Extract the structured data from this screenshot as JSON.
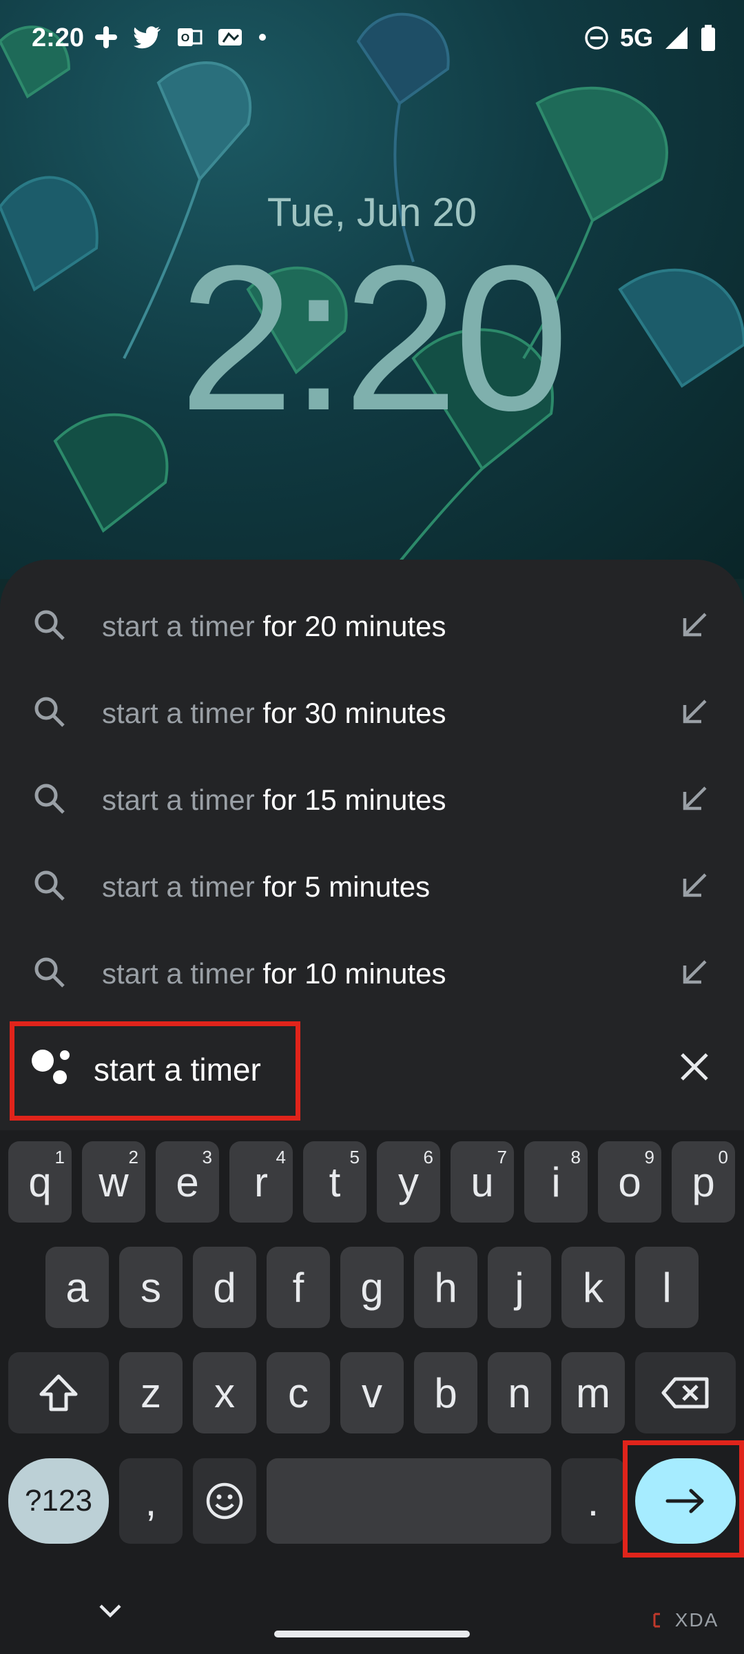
{
  "status_bar": {
    "time": "2:20",
    "network": "5G",
    "icons_left": [
      "slack-icon",
      "twitter-icon",
      "outlook-icon",
      "mlb-icon",
      "dot-icon"
    ],
    "icons_right": [
      "do-not-disturb-icon",
      "signal-icon",
      "battery-icon"
    ]
  },
  "lock_screen": {
    "date": "Tue, Jun 20",
    "clock": "2:20"
  },
  "suggestions": [
    {
      "prefix": "start a timer",
      "suffix": " for 20 minutes"
    },
    {
      "prefix": "start a timer",
      "suffix": " for 30 minutes"
    },
    {
      "prefix": "start a timer",
      "suffix": " for 15 minutes"
    },
    {
      "prefix": "start a timer",
      "suffix": " for 5 minutes"
    },
    {
      "prefix": "start a timer",
      "suffix": " for 10 minutes"
    }
  ],
  "search": {
    "query": "start a timer"
  },
  "keyboard": {
    "row1": [
      {
        "k": "q",
        "h": "1"
      },
      {
        "k": "w",
        "h": "2"
      },
      {
        "k": "e",
        "h": "3"
      },
      {
        "k": "r",
        "h": "4"
      },
      {
        "k": "t",
        "h": "5"
      },
      {
        "k": "y",
        "h": "6"
      },
      {
        "k": "u",
        "h": "7"
      },
      {
        "k": "i",
        "h": "8"
      },
      {
        "k": "o",
        "h": "9"
      },
      {
        "k": "p",
        "h": "0"
      }
    ],
    "row2": [
      "a",
      "s",
      "d",
      "f",
      "g",
      "h",
      "j",
      "k",
      "l"
    ],
    "row3": [
      "z",
      "x",
      "c",
      "v",
      "b",
      "n",
      "m"
    ],
    "symbols_label": "?123",
    "comma": ",",
    "period": "."
  },
  "watermark": "XDA",
  "colors": {
    "highlight": "#e0241b",
    "enter_key": "#a6ecff",
    "panel": "#232426"
  }
}
